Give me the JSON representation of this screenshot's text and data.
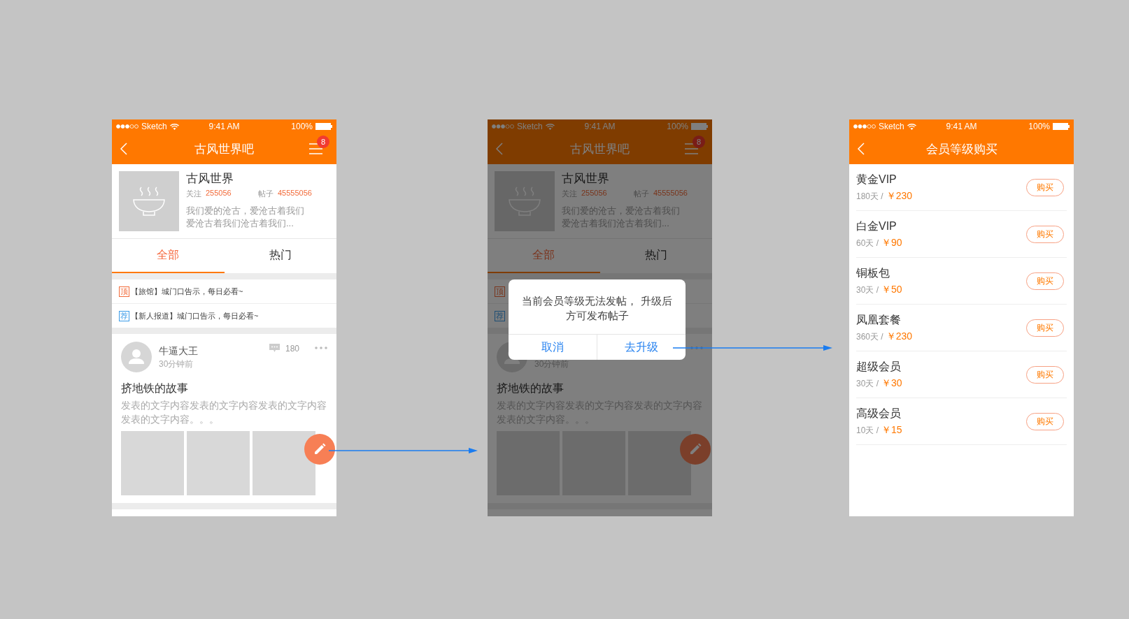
{
  "screens": [
    {
      "kind": "forum",
      "dimmed": false,
      "status_bar": {
        "carrier": "Sketch",
        "time": "9:41 AM",
        "battery": "100%"
      },
      "nav": {
        "title": "古风世界吧",
        "badge": "8"
      },
      "forum": {
        "name": "古风世界",
        "follow_label": "关注",
        "follow_count": "255056",
        "posts_label": "帖子",
        "posts_count": "45555056",
        "description": "我们爱的沧古，爱沧古着我们爱沧古着我们沧古着我们..."
      },
      "tabs": [
        {
          "label": "全部",
          "selected": true
        },
        {
          "label": "热门",
          "selected": false
        }
      ],
      "notices": [
        {
          "kind": "top",
          "tag": "顶",
          "text": "【旅馆】城门口告示，每日必看~"
        },
        {
          "kind": "recommend",
          "tag": "荐",
          "text": "【新人报道】城门口告示，每日必看~"
        }
      ],
      "post": {
        "author": "牛逼大王",
        "time": "30分钟前",
        "comments": "180",
        "title": "挤地铁的故事",
        "body": "发表的文字内容发表的文字内容发表的文字内容发表的文字内容。。。"
      }
    },
    {
      "kind": "forum",
      "dimmed": true,
      "status_bar": {
        "carrier": "Sketch",
        "time": "9:41 AM",
        "battery": "100%"
      },
      "nav": {
        "title": "古风世界吧",
        "badge": "8"
      },
      "forum": {
        "name": "古风世界",
        "follow_label": "关注",
        "follow_count": "255056",
        "posts_label": "帖子",
        "posts_count": "45555056",
        "description": "我们爱的沧古，爱沧古着我们爱沧古着我们沧古着我们..."
      },
      "tabs": [
        {
          "label": "全部",
          "selected": true
        },
        {
          "label": "热门",
          "selected": false
        }
      ],
      "notices": [
        {
          "kind": "top",
          "tag": "顶"
        },
        {
          "kind": "recommend",
          "tag": "荐"
        }
      ],
      "post": {
        "time": "30分钟前",
        "title": "挤地铁的故事",
        "body": "发表的文字内容发表的文字内容发表的文字内容发表的文字内容。。。"
      },
      "dialog": {
        "message": "当前会员等级无法发帖， 升级后方可发布帖子",
        "buttons": [
          "取消",
          "去升级"
        ]
      }
    },
    {
      "kind": "shop",
      "status_bar": {
        "carrier": "Sketch",
        "time": "9:41 AM",
        "battery": "100%"
      },
      "nav": {
        "title": "会员等级购买"
      },
      "plans": [
        {
          "name": "黄金VIP",
          "duration": "180天 /",
          "price": "￥230",
          "button": "购买"
        },
        {
          "name": "白金VIP",
          "duration": "60天 /",
          "price": "￥90",
          "button": "购买"
        },
        {
          "name": "铜板包",
          "duration": "30天 /",
          "price": "￥50",
          "button": "购买"
        },
        {
          "name": "凤凰套餐",
          "duration": "360天 /",
          "price": "￥230",
          "button": "购买"
        },
        {
          "name": "超级会员",
          "duration": "30天 /",
          "price": "￥30",
          "button": "购买"
        },
        {
          "name": "高级会员",
          "duration": "10天 /",
          "price": "￥15",
          "button": "购买"
        }
      ]
    }
  ]
}
